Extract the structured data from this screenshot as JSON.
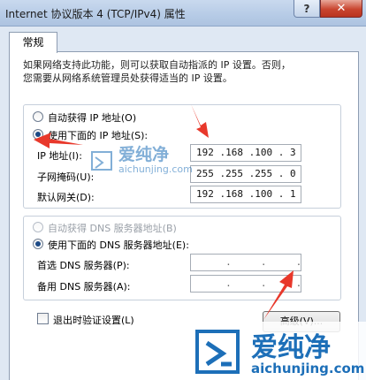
{
  "window": {
    "title": "Internet 协议版本 4 (TCP/IPv4) 属性",
    "help_label": "?",
    "close_label": "✕"
  },
  "tab": {
    "label": "常规"
  },
  "intro": {
    "line1": "如果网络支持此功能，则可以获取自动指派的 IP 设置。否则，",
    "line2": "您需要从网络系统管理员处获得适当的 IP 设置。"
  },
  "ip_section": {
    "auto_label": "自动获得 IP 地址(O)",
    "auto_selected": false,
    "manual_label": "使用下面的 IP 地址(S):",
    "manual_selected": true,
    "ip_label": "IP 地址(I):",
    "ip_value": "192 .168 .100 . 3",
    "mask_label": "子网掩码(U):",
    "mask_value": "255 .255 .255 . 0",
    "gateway_label": "默认网关(D):",
    "gateway_value": "192 .168 .100 . 1"
  },
  "dns_section": {
    "auto_label": "自动获得 DNS 服务器地址(B)",
    "auto_selected": false,
    "auto_disabled": true,
    "manual_label": "使用下面的 DNS 服务器地址(E):",
    "manual_selected": true,
    "preferred_label": "首选 DNS 服务器(P):",
    "preferred_value": "     .     .     .",
    "alternate_label": "备用 DNS 服务器(A):",
    "alternate_value": "     .     .     ."
  },
  "validate": {
    "label": "退出时验证设置(L)",
    "checked": false
  },
  "advanced_button": {
    "label": "高级(V)..."
  },
  "watermark": {
    "brand": "爱纯净",
    "url": "aichunjing.com"
  },
  "colors": {
    "arrow": "#e8382b",
    "watermark_blue": "#1d6fb8"
  }
}
